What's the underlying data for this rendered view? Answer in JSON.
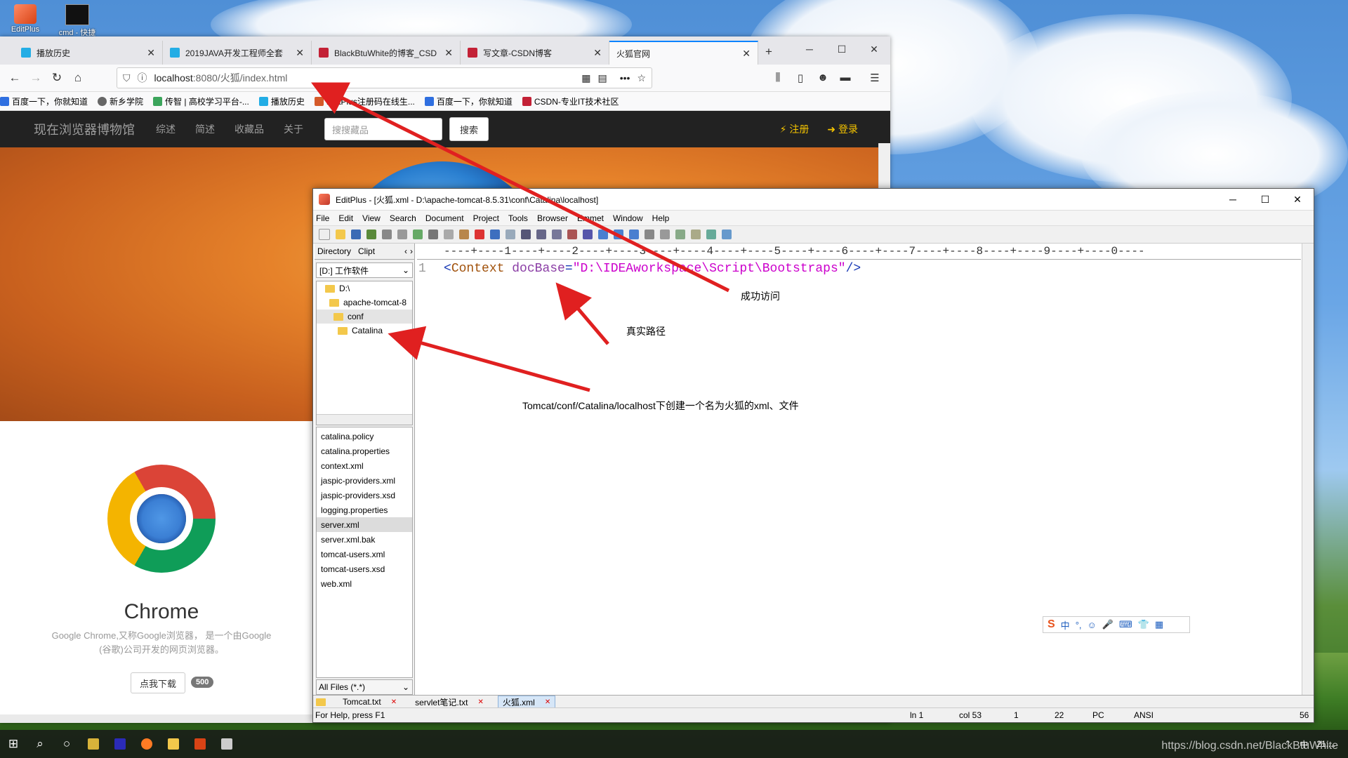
{
  "desktop": {
    "icons": [
      {
        "label": "EditPlus"
      },
      {
        "label": "cmd - 快捷"
      }
    ]
  },
  "firefox": {
    "tabs": [
      {
        "label": "播放历史",
        "active": false
      },
      {
        "label": "2019JAVA开发工程师全套",
        "active": false
      },
      {
        "label": "BlackBtuWhite的博客_CSD",
        "active": false
      },
      {
        "label": "写文章-CSDN博客",
        "active": false
      },
      {
        "label": "火狐官网",
        "active": true
      }
    ],
    "url_host": "localhost",
    "url_rest": ":8080/火狐/index.html",
    "bookmarks": [
      "百度一下，你就知道",
      "新乡学院",
      "传智 | 高校学习平台-...",
      "播放历史",
      "EditPlus注册码在线生...",
      "百度一下，你就知道",
      "CSDN-专业IT技术社区"
    ],
    "site": {
      "brand": "现在浏览器博物馆",
      "links": [
        "综述",
        "简述",
        "收藏品",
        "关于"
      ],
      "search_placeholder": "搜搜藏品",
      "search_button": "搜索",
      "register": "⚡ 注册",
      "login": "➜ 登录"
    },
    "card": {
      "title": "Chrome",
      "desc_line1": "Google Chrome,又称Google浏览器，  是一个由Google",
      "desc_line2": "(谷歌)公司开发的网页浏览器。",
      "button": "点我下载",
      "badge": "500"
    }
  },
  "editplus": {
    "title": "EditPlus - [火狐.xml - D:\\apache-tomcat-8.5.31\\conf\\Catalina\\localhost]",
    "menu": [
      "File",
      "Edit",
      "View",
      "Search",
      "Document",
      "Project",
      "Tools",
      "Browser",
      "Emmet",
      "Window",
      "Help"
    ],
    "dir_tabs": [
      "Directory",
      "Clipt"
    ],
    "drive": "[D:] 工作软件",
    "tree": [
      "D:\\",
      "apache-tomcat-8",
      "conf",
      "Catalina"
    ],
    "files": [
      "catalina.policy",
      "catalina.properties",
      "context.xml",
      "jaspic-providers.xml",
      "jaspic-providers.xsd",
      "logging.properties",
      "server.xml",
      "server.xml.bak",
      "tomcat-users.xml",
      "tomcat-users.xsd",
      "web.xml"
    ],
    "selected_file": "server.xml",
    "filter": "All Files (*.*)",
    "ruler": "----+----1----+----2----+----3----+----4----+----5----+----6----+----7----+----8----+----9----+----0----",
    "code": {
      "line_no": "1",
      "open": "<",
      "tag": "Context",
      "attr": "docBase",
      "eq": "=",
      "value": "\"D:\\IDEAworkspace\\Script\\Bootstraps\"",
      "close": " />"
    },
    "doc_tabs": [
      "Tomcat.txt",
      "servlet笔记.txt",
      "火狐.xml"
    ],
    "active_doc": "火狐.xml",
    "status": {
      "help": "For Help, press F1",
      "ln": "ln 1",
      "col": "col 53",
      "a": "1",
      "b": "22",
      "mode": "PC",
      "enc": "ANSI",
      "num": "56"
    }
  },
  "annotations": {
    "success": "成功访问",
    "real_path": "真实路径",
    "create_note": "Tomcat/conf/Catalina/localhost下创建一个名为火狐的xml、文件"
  },
  "ime": {
    "items": [
      "中",
      "°,",
      "☺",
      "🎤",
      "⌨",
      "👕",
      "▦"
    ]
  },
  "tray": {
    "lang": "中",
    "time": "21:..."
  },
  "watermark": "https://blog.csdn.net/BlackBtuWhite"
}
